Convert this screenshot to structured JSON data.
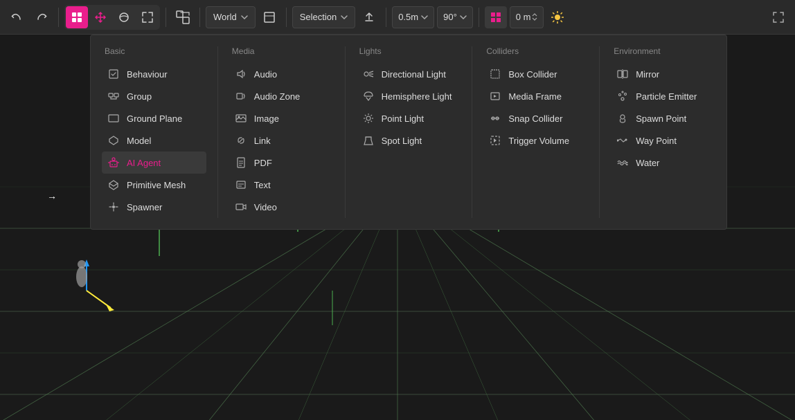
{
  "toolbar": {
    "undo_label": "↩",
    "redo_label": "↪",
    "world_label": "World",
    "world_chevron": "▾",
    "selection_label": "Selection",
    "selection_chevron": "▾",
    "snap_value": "0.5m",
    "snap_chevron": "▾",
    "angle_value": "90°",
    "angle_chevron": "▾",
    "position_value": "0 m",
    "fullscreen_label": "⛶"
  },
  "menu": {
    "basic": {
      "category": "Basic",
      "items": [
        {
          "label": "Behaviour",
          "icon": "behaviour"
        },
        {
          "label": "Group",
          "icon": "group"
        },
        {
          "label": "Ground Plane",
          "icon": "ground-plane"
        },
        {
          "label": "Model",
          "icon": "model"
        },
        {
          "label": "AI Agent",
          "icon": "ai-agent",
          "selected": true
        },
        {
          "label": "Primitive Mesh",
          "icon": "primitive-mesh"
        },
        {
          "label": "Spawner",
          "icon": "spawner"
        }
      ]
    },
    "media": {
      "category": "Media",
      "items": [
        {
          "label": "Audio",
          "icon": "audio"
        },
        {
          "label": "Audio Zone",
          "icon": "audio-zone"
        },
        {
          "label": "Image",
          "icon": "image"
        },
        {
          "label": "Link",
          "icon": "link"
        },
        {
          "label": "PDF",
          "icon": "pdf"
        },
        {
          "label": "Text",
          "icon": "text"
        },
        {
          "label": "Video",
          "icon": "video"
        }
      ]
    },
    "lights": {
      "category": "Lights",
      "items": [
        {
          "label": "Directional Light",
          "icon": "directional-light"
        },
        {
          "label": "Hemisphere Light",
          "icon": "hemisphere-light"
        },
        {
          "label": "Point Light",
          "icon": "point-light"
        },
        {
          "label": "Spot Light",
          "icon": "spot-light"
        }
      ]
    },
    "colliders": {
      "category": "Colliders",
      "items": [
        {
          "label": "Box Collider",
          "icon": "box-collider"
        },
        {
          "label": "Media Frame",
          "icon": "media-frame"
        },
        {
          "label": "Snap Collider",
          "icon": "snap-collider"
        },
        {
          "label": "Trigger Volume",
          "icon": "trigger-volume"
        }
      ]
    },
    "environment": {
      "category": "Environment",
      "items": [
        {
          "label": "Mirror",
          "icon": "mirror"
        },
        {
          "label": "Particle Emitter",
          "icon": "particle-emitter"
        },
        {
          "label": "Spawn Point",
          "icon": "spawn-point"
        },
        {
          "label": "Way Point",
          "icon": "way-point"
        },
        {
          "label": "Water",
          "icon": "water"
        }
      ]
    }
  },
  "viewport": {
    "arrow_label": "→"
  },
  "colors": {
    "accent": "#e91e8c",
    "toolbar_bg": "#2a2a2a",
    "menu_bg": "#2c2c2c",
    "selected_bg": "#3a3a3a",
    "grid_color": "#2d4d2d",
    "text_primary": "#dddddd",
    "text_muted": "#888888"
  }
}
